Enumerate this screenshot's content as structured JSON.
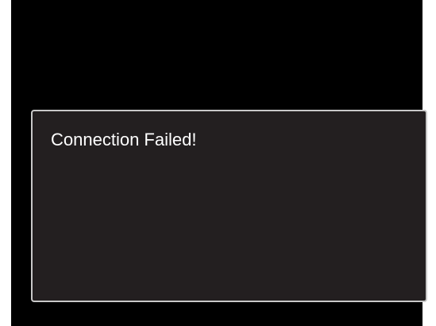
{
  "dialog": {
    "message": "Connection Failed!"
  },
  "colors": {
    "screen_background": "#000000",
    "dialog_background": "#231f20",
    "dialog_border": "#c8c8c8",
    "text": "#ffffff"
  }
}
